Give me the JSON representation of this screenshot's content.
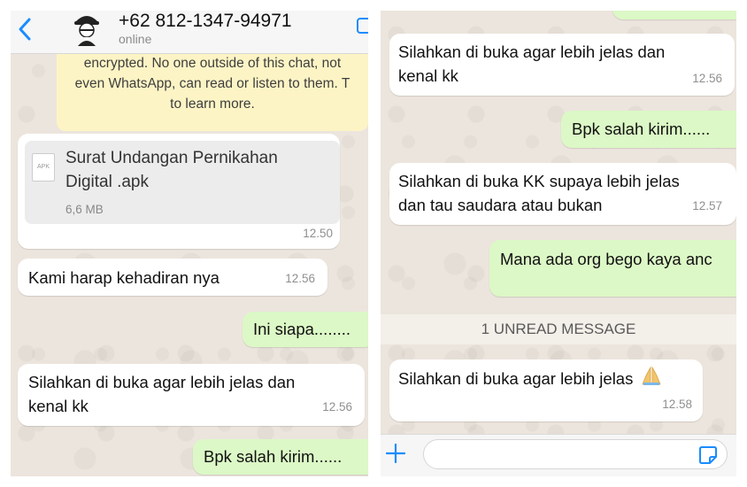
{
  "left_screen": {
    "header": {
      "contact_name": "+62 812-1347-94971",
      "status": "online"
    },
    "encryption_notice": {
      "line1": "encrypted. No one outside of this chat, not",
      "line2": "even WhatsApp, can read or listen to them. T",
      "line3": "to learn more."
    },
    "messages": [
      {
        "type": "document",
        "file_name_line1": "Surat Undangan Pernikahan",
        "file_name_line2": "Digital .apk",
        "file_type": "APK",
        "file_size": "6,6 MB",
        "time": "12.50"
      },
      {
        "type": "incoming",
        "text": "Kami harap kehadiran nya",
        "time": "12.56"
      },
      {
        "type": "outgoing",
        "text": "Ini siapa........"
      },
      {
        "type": "incoming",
        "line1": "Silahkan di buka agar lebih jelas dan",
        "line2": "kenal kk",
        "time": "12.56"
      },
      {
        "type": "outgoing",
        "text": "Bpk salah kirim......"
      }
    ]
  },
  "right_screen": {
    "messages": [
      {
        "type": "incoming",
        "line1": "Silahkan di buka agar lebih jelas dan",
        "line2": "kenal kk",
        "time": "12.56"
      },
      {
        "type": "outgoing",
        "text": "Bpk salah kirim......"
      },
      {
        "type": "incoming",
        "line1": "Silahkan di buka KK supaya lebih jelas",
        "line2": "dan tau saudara atau bukan",
        "time": "12.57"
      },
      {
        "type": "outgoing",
        "text": "Mana ada org bego kaya anc"
      },
      {
        "type": "incoming",
        "text": "Silahkan di buka agar lebih jelas",
        "emoji": "folded-hands",
        "time": "12.58"
      }
    ],
    "unread_divider": "1 UNREAD MESSAGE"
  },
  "colors": {
    "chat_background": "#ece5dd",
    "incoming_bubble": "#ffffff",
    "outgoing_bubble": "#dcf8c6",
    "notice_background": "#fdf4c5",
    "ios_blue": "#1a8cff"
  }
}
